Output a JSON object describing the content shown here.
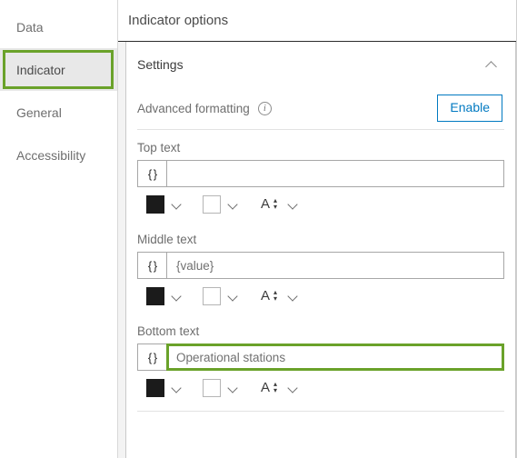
{
  "sidebar": {
    "items": [
      {
        "label": "Data",
        "selected": false,
        "highlighted": false
      },
      {
        "label": "Indicator",
        "selected": true,
        "highlighted": true
      },
      {
        "label": "General",
        "selected": false,
        "highlighted": false
      },
      {
        "label": "Accessibility",
        "selected": false,
        "highlighted": false
      }
    ]
  },
  "header": {
    "title": "Indicator options"
  },
  "settings": {
    "section_title": "Settings",
    "collapse_icon": "chevron-up-icon",
    "advanced_formatting": {
      "label": "Advanced formatting",
      "info_icon": "info-icon",
      "info_glyph": "i",
      "enable_label": "Enable"
    }
  },
  "fields": [
    {
      "label": "Top text",
      "brace_label": "{ }",
      "value": "",
      "placeholder": "",
      "focused": false,
      "format": {
        "text_color": "#1b1b1b",
        "background_color": "#ffffff",
        "font_size_icon": "font-size-icon",
        "font_size_glyph": "A"
      }
    },
    {
      "label": "Middle text",
      "brace_label": "{ }",
      "value": "{value}",
      "placeholder": "",
      "focused": false,
      "format": {
        "text_color": "#1b1b1b",
        "background_color": "#ffffff",
        "font_size_icon": "font-size-icon",
        "font_size_glyph": "A"
      }
    },
    {
      "label": "Bottom text",
      "brace_label": "{ }",
      "value": "Operational stations",
      "placeholder": "",
      "focused": true,
      "format": {
        "text_color": "#1b1b1b",
        "background_color": "#ffffff",
        "font_size_icon": "font-size-icon",
        "font_size_glyph": "A"
      }
    }
  ],
  "colors": {
    "highlight_green": "#6aa22a",
    "link_blue": "#0079c1",
    "selected_gray": "#e8e8e8",
    "panel_gray": "#f3f3f3"
  }
}
